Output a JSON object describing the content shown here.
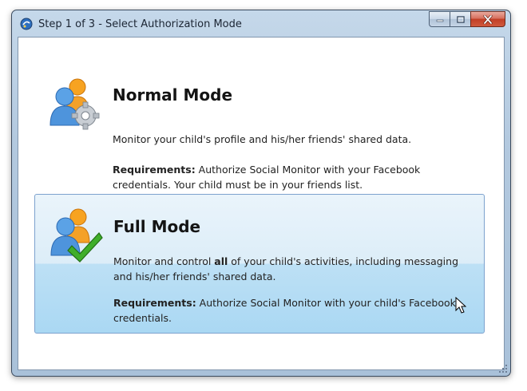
{
  "window": {
    "title": "Step 1 of 3 - Select Authorization Mode"
  },
  "icons": {
    "app": "app-icon",
    "normal_mode": "users-gear-icon",
    "full_mode": "users-checkmark-icon",
    "cursor": "mouse-cursor-icon"
  },
  "modes": {
    "normal": {
      "title": "Normal Mode",
      "description": "Monitor your child's profile and his/her friends' shared data.",
      "requirements_label": "Requirements:",
      "requirements_text": " Authorize Social Monitor with your Facebook credentials. Your child must be in your friends list."
    },
    "full": {
      "title": "Full Mode",
      "description_pre": "Monitor and control ",
      "description_bold": "all",
      "description_post": " of your child's activities, including messaging and his/her friends' shared data.",
      "requirements_label": "Requirements:",
      "requirements_text": " Authorize Social Monitor with your child's Facebook credentials."
    }
  },
  "colors": {
    "accent_border": "#7da2ce",
    "selected_bg": "#bde0f5",
    "close_button": "#c13f26"
  }
}
